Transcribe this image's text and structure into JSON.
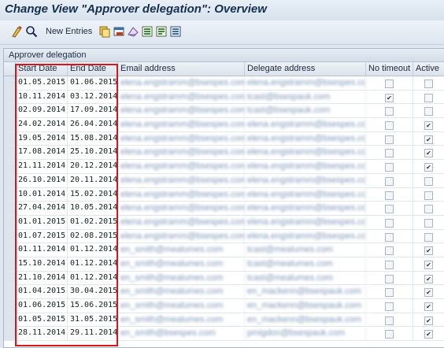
{
  "window": {
    "title": "Change View \"Approver delegation\": Overview"
  },
  "toolbar": {
    "new_entries_label": "New Entries"
  },
  "panel": {
    "title": "Approver delegation"
  },
  "table": {
    "columns": [
      "Start Date",
      "End Date",
      "Email address",
      "Delegate address",
      "No timeout",
      "Active"
    ],
    "rows": [
      {
        "start": "01.05.2015",
        "end": "01.06.2015",
        "email": "elena.engstramm@bsespes.com",
        "delegate": "elena.engstramm@bsespes.com",
        "no_timeout": false,
        "active": false
      },
      {
        "start": "10.11.2014",
        "end": "03.12.2014",
        "email": "elena.engstramm@bsespes.com",
        "delegate": "tcast@bsespauk.com",
        "no_timeout": true,
        "active": false
      },
      {
        "start": "02.09.2014",
        "end": "17.09.2014",
        "email": "elena.engstramm@bsespes.com",
        "delegate": "tcast@bsespauk.com",
        "no_timeout": false,
        "active": false
      },
      {
        "start": "24.02.2014",
        "end": "26.04.2014",
        "email": "elena.engstramm@bsespes.com",
        "delegate": "elena.engstramm@bsespes.com",
        "no_timeout": false,
        "active": true
      },
      {
        "start": "19.05.2014",
        "end": "15.08.2014",
        "email": "elena.engstramm@bsespes.com",
        "delegate": "elena.engstramm@bsespes.com",
        "no_timeout": false,
        "active": true
      },
      {
        "start": "17.08.2014",
        "end": "25.10.2014",
        "email": "elena.engstramm@bsespes.com",
        "delegate": "elena.engstramm@bsespes.com",
        "no_timeout": false,
        "active": true
      },
      {
        "start": "21.11.2014",
        "end": "20.12.2014",
        "email": "elena.engstramm@bsespes.com",
        "delegate": "elena.engstramm@bsespes.com",
        "no_timeout": false,
        "active": true
      },
      {
        "start": "26.10.2014",
        "end": "20.11.2014",
        "email": "elena.engstramm@bsespes.com",
        "delegate": "elena.engstramm@bsespes.com",
        "no_timeout": false,
        "active": false
      },
      {
        "start": "10.01.2014",
        "end": "15.02.2014",
        "email": "elena.engstramm@bsespes.com",
        "delegate": "elena.engstramm@bsespes.com",
        "no_timeout": false,
        "active": false
      },
      {
        "start": "27.04.2014",
        "end": "10.05.2014",
        "email": "elena.engstramm@bsespes.com",
        "delegate": "elena.engstramm@bsespes.com",
        "no_timeout": false,
        "active": false
      },
      {
        "start": "01.01.2015",
        "end": "01.02.2015",
        "email": "elena.engstramm@bsespes.com",
        "delegate": "elena.engstramm@bsespes.com",
        "no_timeout": false,
        "active": false
      },
      {
        "start": "01.07.2015",
        "end": "02.08.2015",
        "email": "elena.engstramm@bsespes.com",
        "delegate": "elena.engstramm@bsespes.com",
        "no_timeout": false,
        "active": false
      },
      {
        "start": "01.11.2014",
        "end": "01.12.2014",
        "email": "en_smith@mealumes.com",
        "delegate": "tcast@mealumes.com",
        "no_timeout": false,
        "active": true
      },
      {
        "start": "15.10.2014",
        "end": "01.12.2014",
        "email": "en_smith@mealumes.com",
        "delegate": "tcast@mealumes.com",
        "no_timeout": false,
        "active": true
      },
      {
        "start": "21.10.2014",
        "end": "01.12.2014",
        "email": "en_smith@mealumes.com",
        "delegate": "tcast@mealumes.com",
        "no_timeout": false,
        "active": true
      },
      {
        "start": "01.04.2015",
        "end": "30.04.2015",
        "email": "en_smith@mealumes.com",
        "delegate": "en_mackenn@bsespauk.com",
        "no_timeout": false,
        "active": true
      },
      {
        "start": "01.06.2015",
        "end": "15.06.2015",
        "email": "en_smith@mealumes.com",
        "delegate": "en_mackenn@bsespauk.com",
        "no_timeout": false,
        "active": true
      },
      {
        "start": "01.05.2015",
        "end": "31.05.2015",
        "email": "en_smith@mealumes.com",
        "delegate": "en_mackenn@bsespauk.com",
        "no_timeout": false,
        "active": true
      },
      {
        "start": "28.11.2014",
        "end": "29.11.2014",
        "email": "en_smith@bsespes.com",
        "delegate": "pmigdon@bsespauk.com",
        "no_timeout": false,
        "active": true
      }
    ]
  }
}
